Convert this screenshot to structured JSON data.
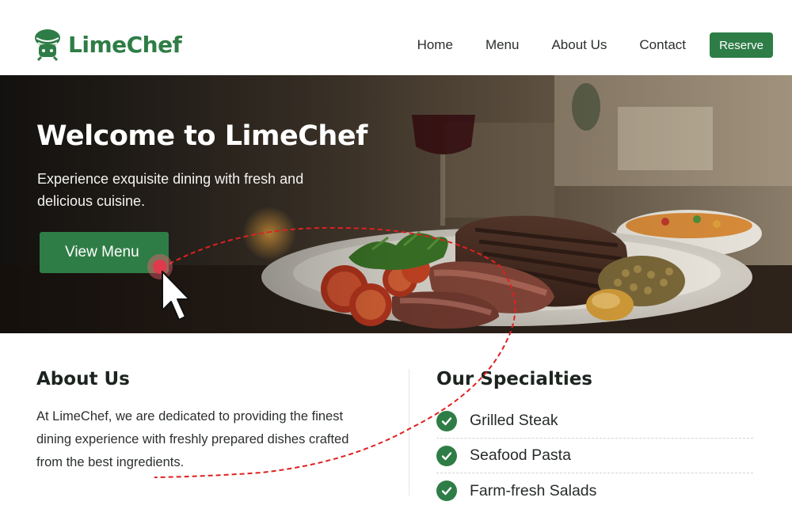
{
  "brand": {
    "name": "LimeChef",
    "color": "#2e7d46"
  },
  "nav": {
    "items": [
      "Home",
      "Menu",
      "About Us",
      "Contact"
    ],
    "reserve_label": "Reserve"
  },
  "hero": {
    "title": "Welcome to LimeChef",
    "subtitle": "Experience exquisite dining with fresh and delicious cuisine.",
    "cta_label": "View Menu"
  },
  "about": {
    "title": "About Us",
    "text": "At LimeChef, we are dedicated to providing the finest dining experience with freshly prepared dishes crafted from the best ingredients."
  },
  "specialties": {
    "title": "Our Specialties",
    "items": [
      "Grilled Steak",
      "Seafood Pasta",
      "Farm-fresh Salads"
    ]
  },
  "icons": {
    "logo": "chef-hat-icon",
    "check": "check-circle-icon",
    "cursor": "mouse-pointer-icon"
  }
}
